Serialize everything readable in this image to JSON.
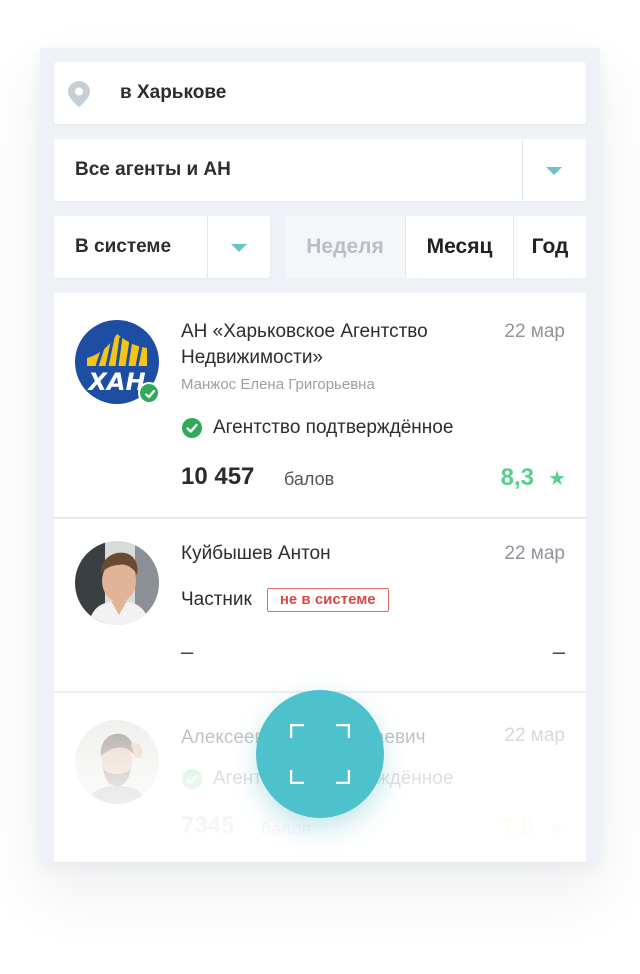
{
  "filters": {
    "city": "в Харькове",
    "agents": "Все агенты и АН",
    "status": "В системе",
    "period_tabs": [
      "Неделя",
      "Месяц",
      "Год"
    ],
    "active_period": "Неделя"
  },
  "colors": {
    "accent": "#4dc2cc",
    "verified": "#2faa5a",
    "rating_green": "#5bcf8a",
    "rating_yellow": "#f0d874",
    "not_in_system": "#d84848"
  },
  "list": [
    {
      "name": "АН «Харьковское Агентство Недвижимости»",
      "date": "22 мар",
      "owner": "Манжос Елена Григорьевна",
      "logo_text": "ХАН",
      "badge": "Агентство подтверждённое",
      "score": "10 457",
      "score_unit": "балов",
      "rating": "8,3",
      "rating_icon": "star-icon"
    },
    {
      "name": "Куйбышев Антон",
      "date": "22 мар",
      "type": "Частник",
      "status_tag": "не в системе",
      "score": "–",
      "rating": "–"
    },
    {
      "name": "Алексеев Иван Николаевич",
      "date": "22 мар",
      "badge": "Агентство подтверждённое",
      "score": "7345",
      "score_unit": "балов",
      "rating": "7,8",
      "rating_icon": "star-icon"
    }
  ],
  "fab": {
    "icon": "scan-frame-icon"
  }
}
